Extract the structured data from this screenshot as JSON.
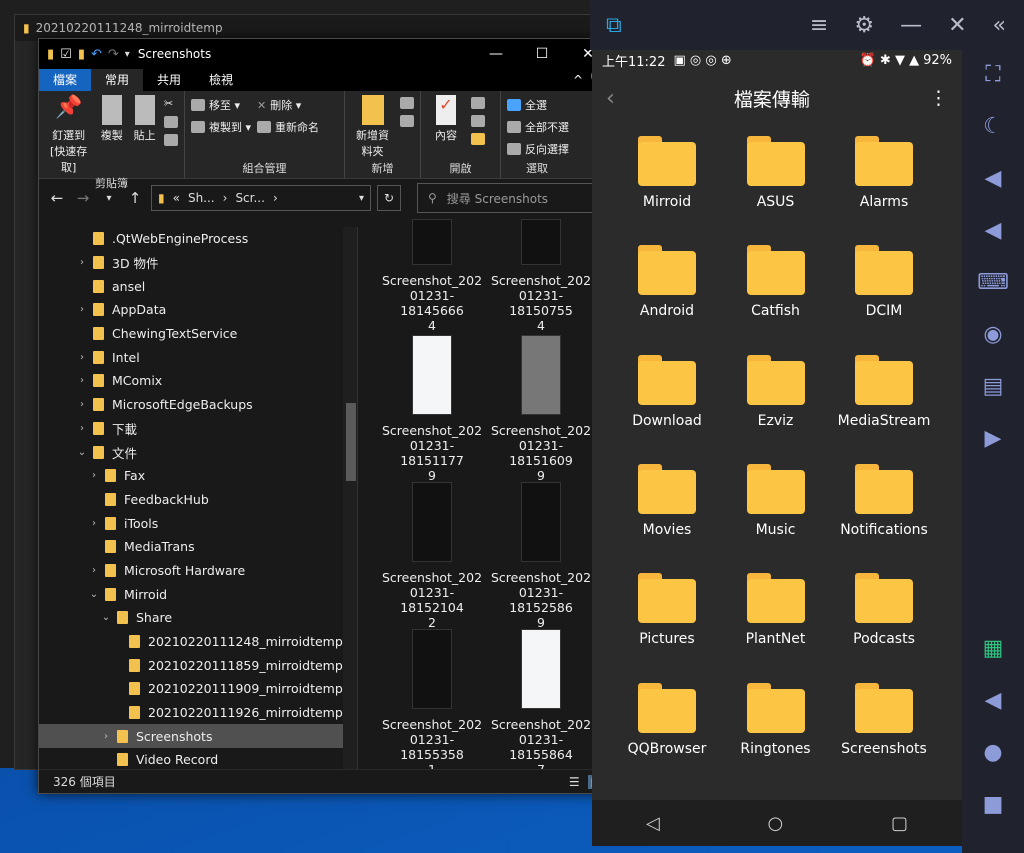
{
  "back_window": {
    "title": "20210220111248_mirroidtemp"
  },
  "explorer": {
    "title": "Screenshots",
    "tabs": [
      "檔案",
      "常用",
      "共用",
      "檢視"
    ],
    "ribbon": {
      "clipboard": {
        "label": "剪貼簿",
        "pin": "釘選到 [快速存取]",
        "copy": "複製",
        "paste": "貼上"
      },
      "organize": {
        "label": "組合管理",
        "move": "移至 ▾",
        "copyto": "複製到 ▾",
        "delete": "刪除 ▾",
        "rename": "重新命名"
      },
      "new": {
        "label": "新增",
        "newfolder": "新增資料夾"
      },
      "open": {
        "label": "開啟",
        "props": "內容"
      },
      "select": {
        "label": "選取",
        "all": "全選",
        "none": "全部不選",
        "invert": "反向選擇"
      }
    },
    "address": {
      "seg1": "Sh...",
      "seg2": "Scr...",
      "prefix": "«"
    },
    "search_placeholder": "搜尋 Screenshots",
    "tree": [
      {
        "label": ".QtWebEngineProcess",
        "indent": 0,
        "chev": ""
      },
      {
        "label": "3D 物件",
        "indent": 0,
        "chev": ">"
      },
      {
        "label": "ansel",
        "indent": 0,
        "chev": ""
      },
      {
        "label": "AppData",
        "indent": 0,
        "chev": ">"
      },
      {
        "label": "ChewingTextService",
        "indent": 0,
        "chev": ""
      },
      {
        "label": "Intel",
        "indent": 0,
        "chev": ">"
      },
      {
        "label": "MComix",
        "indent": 0,
        "chev": ">"
      },
      {
        "label": "MicrosoftEdgeBackups",
        "indent": 0,
        "chev": ">"
      },
      {
        "label": "下載",
        "indent": 0,
        "chev": ">"
      },
      {
        "label": "文件",
        "indent": 0,
        "chev": "v"
      },
      {
        "label": "Fax",
        "indent": 1,
        "chev": ">"
      },
      {
        "label": "FeedbackHub",
        "indent": 1,
        "chev": ""
      },
      {
        "label": "iTools",
        "indent": 1,
        "chev": ">"
      },
      {
        "label": "MediaTrans",
        "indent": 1,
        "chev": ""
      },
      {
        "label": "Microsoft Hardware",
        "indent": 1,
        "chev": ">"
      },
      {
        "label": "Mirroid",
        "indent": 1,
        "chev": "v"
      },
      {
        "label": "Share",
        "indent": 2,
        "chev": "v"
      },
      {
        "label": "20210220111248_mirroidtemp",
        "indent": 3,
        "chev": ""
      },
      {
        "label": "20210220111859_mirroidtemp",
        "indent": 3,
        "chev": ""
      },
      {
        "label": "20210220111909_mirroidtemp",
        "indent": 3,
        "chev": ""
      },
      {
        "label": "20210220111926_mirroidtemp",
        "indent": 3,
        "chev": ""
      },
      {
        "label": "Screenshots",
        "indent": 2,
        "chev": ">",
        "selected": true
      },
      {
        "label": "Video Record",
        "indent": 2,
        "chev": ""
      }
    ],
    "files": [
      {
        "name": "Screenshot_20201231-181456664",
        "l1": "Screenshot_202",
        "l2": "01231-18145666",
        "l3": "4",
        "thumb": "dark"
      },
      {
        "name": "Screenshot_20201231-181507554",
        "l1": "Screenshot_202",
        "l2": "01231-18150755",
        "l3": "4",
        "thumb": "dark"
      },
      {
        "name": "Screenshot_20201231-181511779",
        "l1": "Screenshot_202",
        "l2": "01231-18151177",
        "l3": "9",
        "thumb": "light"
      },
      {
        "name": "Screenshot_20201231-181516099",
        "l1": "Screenshot_202",
        "l2": "01231-18151609",
        "l3": "9",
        "thumb": "gray"
      },
      {
        "name": "Screenshot_20201231-181521042",
        "l1": "Screenshot_202",
        "l2": "01231-18152104",
        "l3": "2",
        "thumb": "dark"
      },
      {
        "name": "Screenshot_20201231-181525869",
        "l1": "Screenshot_202",
        "l2": "01231-18152586",
        "l3": "9",
        "thumb": "dark"
      },
      {
        "name": "Screenshot_20201231-181553581",
        "l1": "Screenshot_202",
        "l2": "01231-18155358",
        "l3": "1",
        "thumb": "dark"
      },
      {
        "name": "Screenshot_20201231-181558647",
        "l1": "Screenshot_202",
        "l2": "01231-18155864",
        "l3": "7",
        "thumb": "light"
      }
    ],
    "status": "326 個項目"
  },
  "phone": {
    "status_time": "上午11:22",
    "battery": "92%",
    "app_title": "檔案傳輸",
    "folders": [
      "Mirroid",
      "ASUS",
      "Alarms",
      "Android",
      "Catfish",
      "DCIM",
      "Download",
      "Ezviz",
      "MediaStream",
      "Movies",
      "Music",
      "Notifications",
      "Pictures",
      "PlantNet",
      "Podcasts",
      "QQBrowser",
      "Ringtones",
      "Screenshots"
    ]
  },
  "colors": {
    "accent": "#1565c0",
    "folder": "#fcc544",
    "phone_bg": "#2b2b2b"
  }
}
